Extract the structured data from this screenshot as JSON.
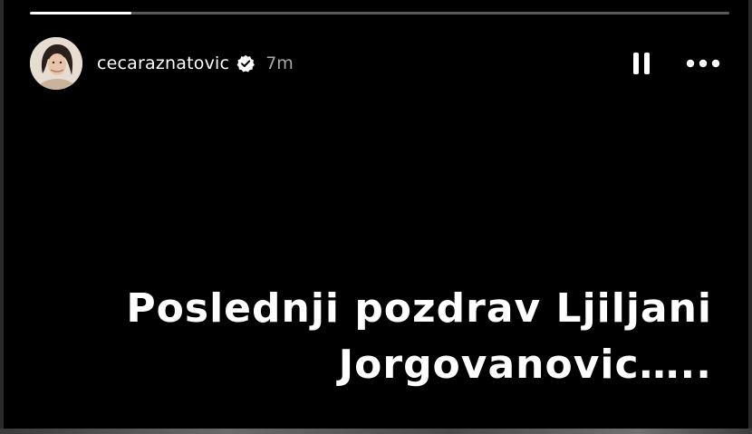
{
  "story": {
    "progress": 0.145,
    "username": "cecaraznatovic",
    "timestamp": "7m",
    "caption_line1": "Poslednji pozdrav Ljiljani",
    "caption_line2": "Jorgovanovic….."
  },
  "icons": {
    "verified": "verified-badge-icon",
    "pause": "pause-icon",
    "more": "more-options-icon"
  },
  "colors": {
    "background": "#000000",
    "text": "#ffffff",
    "timestamp": "#a8a8a8"
  }
}
